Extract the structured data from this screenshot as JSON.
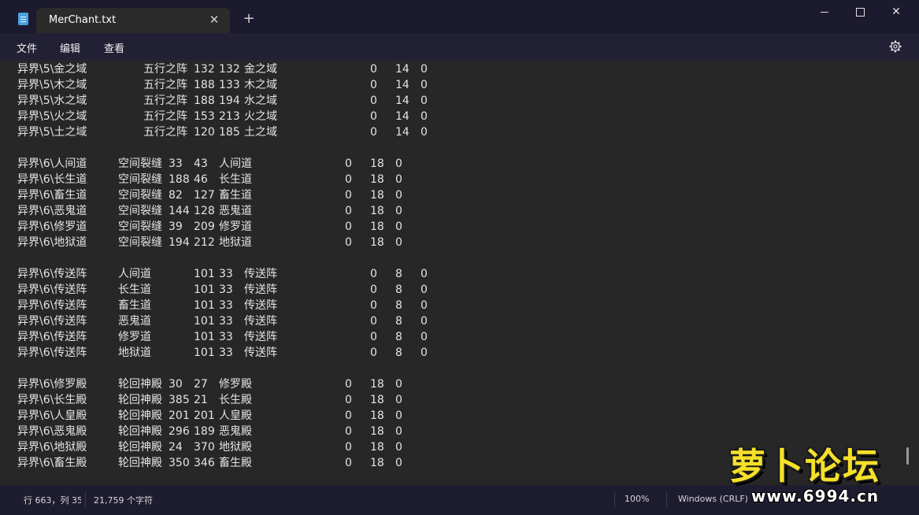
{
  "window": {
    "tab_title": "MerChant.txt",
    "tab_close": "✕",
    "new_tab": "+",
    "close_symbol": "✕"
  },
  "menu": {
    "file": "文件",
    "edit": "编辑",
    "view": "查看"
  },
  "lines": [
    {
      "c1": "异界\\5\\金之域",
      "c2": "五行之阵",
      "c3": "132",
      "c4": "132",
      "c5": "金之域",
      "c6": "0",
      "c7": "14",
      "c8": "0"
    },
    {
      "c1": "异界\\5\\木之域",
      "c2": "五行之阵",
      "c3": "188",
      "c4": "133",
      "c5": "木之域",
      "c6": "0",
      "c7": "14",
      "c8": "0"
    },
    {
      "c1": "异界\\5\\水之域",
      "c2": "五行之阵",
      "c3": "188",
      "c4": "194",
      "c5": "水之域",
      "c6": "0",
      "c7": "14",
      "c8": "0"
    },
    {
      "c1": "异界\\5\\火之域",
      "c2": "五行之阵",
      "c3": "153",
      "c4": "213",
      "c5": "火之域",
      "c6": "0",
      "c7": "14",
      "c8": "0"
    },
    {
      "c1": "异界\\5\\土之域",
      "c2": "五行之阵",
      "c3": "120",
      "c4": "185",
      "c5": "土之域",
      "c6": "0",
      "c7": "14",
      "c8": "0"
    },
    {
      "c1": "",
      "c2": "",
      "c3": "",
      "c4": "",
      "c5": "",
      "c6": "",
      "c7": "",
      "c8": ""
    },
    {
      "c1": "异界\\6\\人间道",
      "c2": "空间裂缝",
      "c3": "33",
      "c4": "43",
      "c5": "人间道",
      "c6": "0",
      "c7": "18",
      "c8": "0"
    },
    {
      "c1": "异界\\6\\长生道",
      "c2": "空间裂缝",
      "c3": "188",
      "c4": "46",
      "c5": "长生道",
      "c6": "0",
      "c7": "18",
      "c8": "0"
    },
    {
      "c1": "异界\\6\\畜生道",
      "c2": "空间裂缝",
      "c3": "82",
      "c4": "127",
      "c5": "畜生道",
      "c6": "0",
      "c7": "18",
      "c8": "0"
    },
    {
      "c1": "异界\\6\\恶鬼道",
      "c2": "空间裂缝",
      "c3": "144",
      "c4": "128",
      "c5": "恶鬼道",
      "c6": "0",
      "c7": "18",
      "c8": "0"
    },
    {
      "c1": "异界\\6\\修罗道",
      "c2": "空间裂缝",
      "c3": "39",
      "c4": "209",
      "c5": "修罗道",
      "c6": "0",
      "c7": "18",
      "c8": "0"
    },
    {
      "c1": "异界\\6\\地狱道",
      "c2": "空间裂缝",
      "c3": "194",
      "c4": "212",
      "c5": "地狱道",
      "c6": "0",
      "c7": "18",
      "c8": "0"
    },
    {
      "c1": "",
      "c2": "",
      "c3": "",
      "c4": "",
      "c5": "",
      "c6": "",
      "c7": "",
      "c8": ""
    },
    {
      "c1": "异界\\6\\传送阵",
      "c2": "人间道",
      "c3": "101",
      "c4": "33",
      "c5": "传送阵",
      "c6": "0",
      "c7": "8",
      "c8": "0"
    },
    {
      "c1": "异界\\6\\传送阵",
      "c2": "长生道",
      "c3": "101",
      "c4": "33",
      "c5": "传送阵",
      "c6": "0",
      "c7": "8",
      "c8": "0"
    },
    {
      "c1": "异界\\6\\传送阵",
      "c2": "畜生道",
      "c3": "101",
      "c4": "33",
      "c5": "传送阵",
      "c6": "0",
      "c7": "8",
      "c8": "0"
    },
    {
      "c1": "异界\\6\\传送阵",
      "c2": "恶鬼道",
      "c3": "101",
      "c4": "33",
      "c5": "传送阵",
      "c6": "0",
      "c7": "8",
      "c8": "0"
    },
    {
      "c1": "异界\\6\\传送阵",
      "c2": "修罗道",
      "c3": "101",
      "c4": "33",
      "c5": "传送阵",
      "c6": "0",
      "c7": "8",
      "c8": "0"
    },
    {
      "c1": "异界\\6\\传送阵",
      "c2": "地狱道",
      "c3": "101",
      "c4": "33",
      "c5": "传送阵",
      "c6": "0",
      "c7": "8",
      "c8": "0"
    },
    {
      "c1": "",
      "c2": "",
      "c3": "",
      "c4": "",
      "c5": "",
      "c6": "",
      "c7": "",
      "c8": ""
    },
    {
      "c1": "异界\\6\\修罗殿",
      "c2": "轮回神殿",
      "c3": "30",
      "c4": "27",
      "c5": "修罗殿",
      "c6": "0",
      "c7": "18",
      "c8": "0"
    },
    {
      "c1": "异界\\6\\长生殿",
      "c2": "轮回神殿",
      "c3": "385",
      "c4": "21",
      "c5": "长生殿",
      "c6": "0",
      "c7": "18",
      "c8": "0"
    },
    {
      "c1": "异界\\6\\人皇殿",
      "c2": "轮回神殿",
      "c3": "201",
      "c4": "201",
      "c5": "人皇殿",
      "c6": "0",
      "c7": "18",
      "c8": "0"
    },
    {
      "c1": "异界\\6\\恶鬼殿",
      "c2": "轮回神殿",
      "c3": "296",
      "c4": "189",
      "c5": "恶鬼殿",
      "c6": "0",
      "c7": "18",
      "c8": "0"
    },
    {
      "c1": "异界\\6\\地狱殿",
      "c2": "轮回神殿",
      "c3": "24",
      "c4": "370",
      "c5": "地狱殿",
      "c6": "0",
      "c7": "18",
      "c8": "0"
    },
    {
      "c1": "异界\\6\\畜生殿",
      "c2": "轮回神殿",
      "c3": "350",
      "c4": "346",
      "c5": "畜生殿",
      "c6": "0",
      "c7": "18",
      "c8": "0"
    }
  ],
  "status": {
    "position": "行 663，列 35",
    "char_count": "21,759 个字符",
    "zoom": "100%",
    "line_ending": "Windows (CRLF)"
  },
  "watermark": {
    "title": "萝卜论坛",
    "url": "www.6994.cn"
  }
}
